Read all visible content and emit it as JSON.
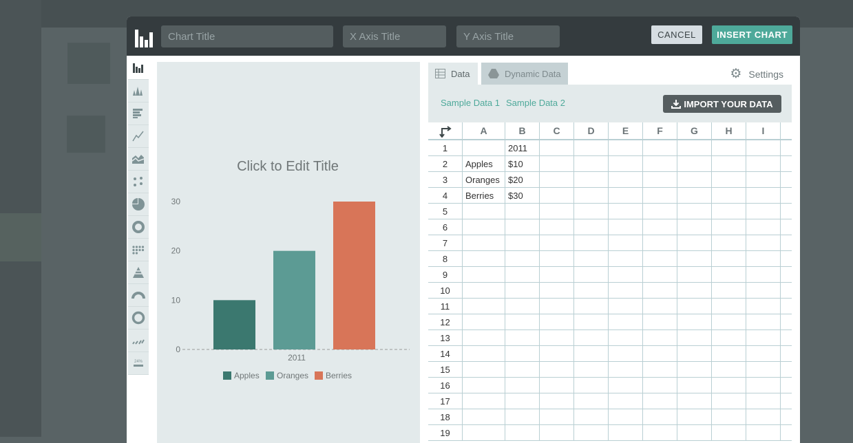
{
  "dialog": {
    "chart_title_placeholder": "Chart Title",
    "x_axis_placeholder": "X Axis Title",
    "y_axis_placeholder": "Y Axis Title",
    "cancel_label": "CANCEL",
    "insert_label": "INSERT CHART",
    "accent": "#4ea99a"
  },
  "chart_types": [
    "bar-chart-icon",
    "histogram-icon",
    "horizontal-bar-icon",
    "line-chart-icon",
    "area-chart-icon",
    "scatter-icon",
    "pie-chart-icon",
    "donut-chart-icon",
    "dot-grid-icon",
    "pyramid-icon",
    "gauge-icon",
    "ring-icon",
    "sparkline-icon",
    "progress-bar-icon"
  ],
  "progress_icon_text": "24%",
  "tabs": {
    "data": "Data",
    "dynamic": "Dynamic Data",
    "settings": "Settings"
  },
  "toolbar": {
    "sample1": "Sample Data 1",
    "sample2": "Sample Data 2",
    "import": "IMPORT YOUR DATA"
  },
  "sheet": {
    "columns": [
      "A",
      "B",
      "C",
      "D",
      "E",
      "F",
      "G",
      "H",
      "I"
    ],
    "rows": [
      [
        "",
        "2011"
      ],
      [
        "Apples",
        "$10"
      ],
      [
        "Oranges",
        "$20"
      ],
      [
        "Berries",
        "$30"
      ],
      [],
      [],
      [],
      [],
      [],
      [],
      [],
      [],
      [],
      [],
      [],
      [],
      [],
      [],
      []
    ]
  },
  "chart_data": {
    "type": "bar",
    "title": "Click to Edit Title",
    "categories": [
      "2011"
    ],
    "series": [
      {
        "name": "Apples",
        "values": [
          10
        ],
        "color": "#3b786f"
      },
      {
        "name": "Oranges",
        "values": [
          20
        ],
        "color": "#5c9b94"
      },
      {
        "name": "Berries",
        "values": [
          30
        ],
        "color": "#d87558"
      }
    ],
    "yticks": [
      0,
      10,
      20,
      30
    ],
    "ylim": [
      0,
      30
    ],
    "legend": "bottom",
    "grid": false
  }
}
